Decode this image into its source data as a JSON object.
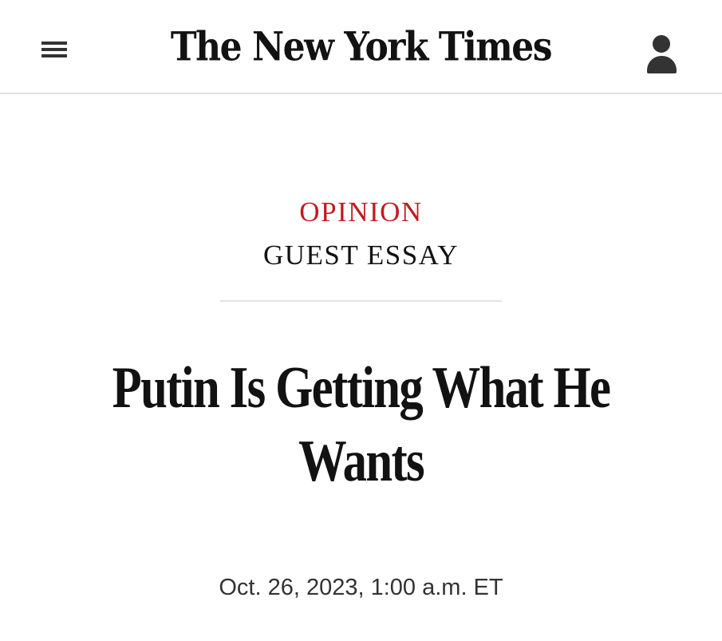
{
  "header": {
    "menu_icon": "hamburger-menu-icon",
    "logo_text": "The New York Times",
    "account_icon": "user-account-icon"
  },
  "article": {
    "section": "OPINION",
    "subsection": "GUEST ESSAY",
    "headline": "Putin Is Getting What He Wants",
    "dateline": "Oct. 26, 2023, 1:00 a.m. ET"
  },
  "colors": {
    "opinion_accent": "#c41a1f",
    "text": "#121212",
    "divider": "#e2e2e2"
  }
}
